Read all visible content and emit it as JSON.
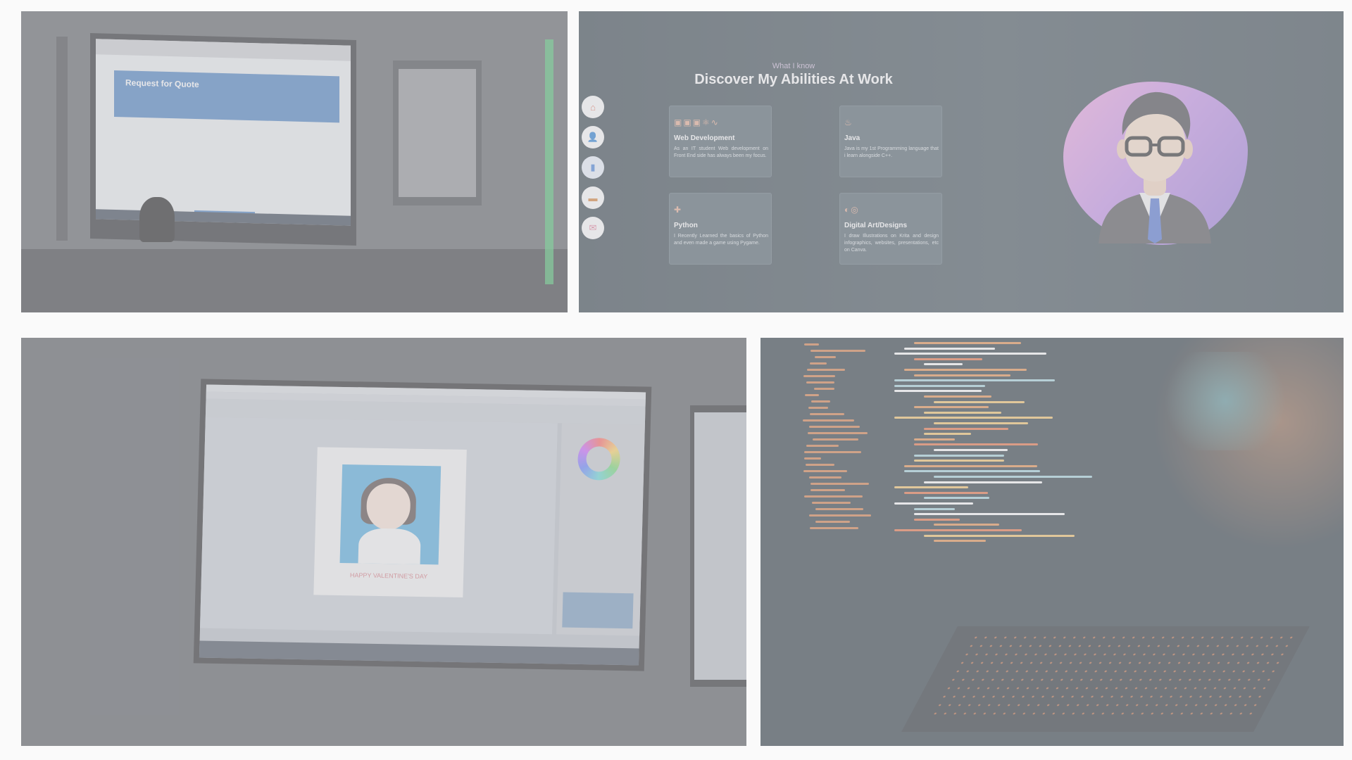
{
  "portfolio": {
    "eyebrow": "What I know",
    "title": "Discover My Abilities At Work",
    "nav": [
      {
        "icon": "home-icon"
      },
      {
        "icon": "user-icon"
      },
      {
        "icon": "book-icon"
      },
      {
        "icon": "briefcase-icon"
      },
      {
        "icon": "mail-icon"
      }
    ],
    "cards": [
      {
        "title": "Web Development",
        "description": "As an IT student Web development on Front End side has always been my focus.",
        "icons": [
          "html-icon",
          "css-icon",
          "js-icon",
          "react-icon",
          "sass-icon"
        ]
      },
      {
        "title": "Java",
        "description": "Java is my 1st Programming language that i learn alongside C++.",
        "icons": [
          "java-icon"
        ]
      },
      {
        "title": "Python",
        "description": "I Recently Learned the basics of Python and even made a game using Pygame.",
        "icons": [
          "python-icon"
        ]
      },
      {
        "title": "Digital Art/Designs",
        "description": "I draw Illustrations on Krita and design infographics, websites, presentations, etc on Canva.",
        "icons": [
          "krita-icon",
          "canva-icon"
        ]
      }
    ]
  },
  "quote_screen": {
    "heading": "Request for Quote"
  },
  "drawing": {
    "caption": "HAPPY VALENTINE'S DAY"
  },
  "colors": {
    "blob_start": "#f3a3e0",
    "blob_end": "#8f72d8",
    "card_bg": "#495a64",
    "tile_veil": "#cdcdd2"
  }
}
